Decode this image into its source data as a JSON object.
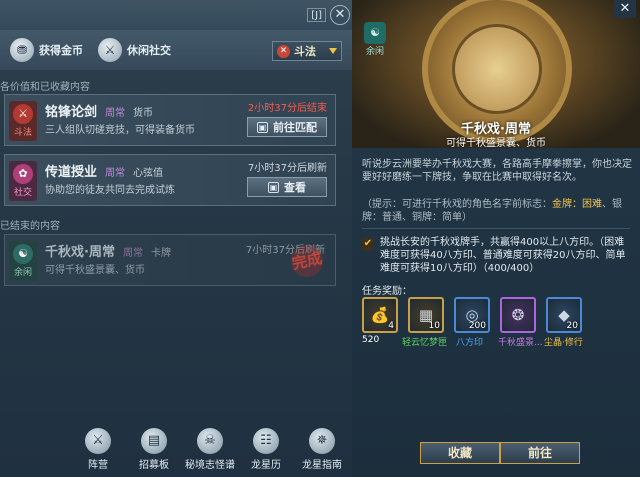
{
  "left_panel": {
    "hotkey": "[J]",
    "nav": {
      "earn_coins": "获得金币",
      "casual_social": "休闲社交"
    },
    "filter": {
      "selected": "斗法"
    },
    "section_value": "各价值和已收藏内容",
    "section_ended": "已结束的内容",
    "cards": [
      {
        "badge": "斗法",
        "title": "铭锋论剑",
        "period": "周常",
        "reward": "货币",
        "desc": "三人组队切磋竞技，可得装备货币",
        "time": "2小时37分后结束",
        "button": "前往匹配"
      },
      {
        "badge": "社交",
        "title": "传道授业",
        "period": "周常",
        "reward": "心弦值",
        "desc": "协助您的徒友共同去完成试炼",
        "time": "7小时37分后刷新",
        "button": "查看"
      },
      {
        "badge": "余闲",
        "title": "千秋戏·周常",
        "period": "周常",
        "reward": "卡牌",
        "desc": "可得千秋盛景囊、货币",
        "time": "7小时37分后刷新",
        "stamp": "完成"
      }
    ],
    "bottom_nav": [
      "阵营",
      "招募板",
      "秘境志怪谱",
      "龙星历",
      "龙星指南"
    ]
  },
  "right_panel": {
    "category": "余闲",
    "title": "千秋戏·周常",
    "subtitle": "可得千秋盛景囊、货币",
    "story": "听说步云洲要举办千秋戏大赛，各路高手摩拳擦掌，你也决定要好好磨练一下牌技，争取在比赛中取得好名次。",
    "hint_prefix": "（提示：可进行千秋戏的角色名字前标志：",
    "hint_gold": "金牌：困难",
    "hint_silver": "银牌：普通",
    "hint_bronze": "铜牌：简单",
    "hint_suffix": "）",
    "task": "挑战长安的千秋戏牌手，共赢得400以上八方印。（困难难度可获得40八方印、普通难度可获得20八方印、简单难度可获得10八方印）（400/400）",
    "rewards_label": "任务奖励：",
    "rewards": [
      {
        "icon": "coin-bag-icon",
        "qty": "4",
        "name": "520",
        "color": "#ffffff"
      },
      {
        "icon": "dream-icon",
        "qty": "10",
        "name": "轻云忆梦匣",
        "color": "#5fd35f"
      },
      {
        "icon": "seal-icon",
        "qty": "200",
        "name": "八方印",
        "color": "#4aa7ff"
      },
      {
        "icon": "treasure-bag-icon",
        "qty": "",
        "name": "千秋盛景...",
        "color": "#c97be8"
      },
      {
        "icon": "crystal-icon",
        "qty": "20",
        "name": "尘晶·修行",
        "color": "#f2c24a"
      }
    ],
    "collect_button": "收藏",
    "go_button": "前往"
  }
}
